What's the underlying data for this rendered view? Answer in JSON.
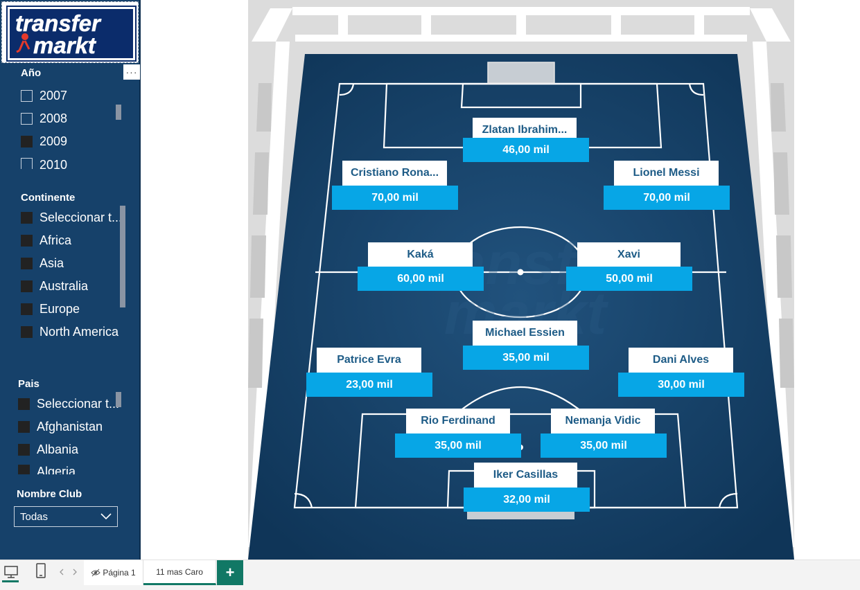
{
  "logo": {
    "line1": "transfer",
    "line2": "markt"
  },
  "slicers": {
    "year": {
      "title": "Año",
      "more_label": "···",
      "items": [
        {
          "label": "2007",
          "checked": false
        },
        {
          "label": "2008",
          "checked": false
        },
        {
          "label": "2009",
          "checked": true
        },
        {
          "label": "2010",
          "checked": false
        }
      ]
    },
    "continent": {
      "title": "Continente",
      "items": [
        {
          "label": "Seleccionar t...",
          "checked": true
        },
        {
          "label": "Africa",
          "checked": true
        },
        {
          "label": "Asia",
          "checked": true
        },
        {
          "label": "Australia",
          "checked": true
        },
        {
          "label": "Europe",
          "checked": true
        },
        {
          "label": "North America",
          "checked": true
        }
      ]
    },
    "country": {
      "title": "Pais",
      "items": [
        {
          "label": "Seleccionar t...",
          "checked": true
        },
        {
          "label": "Afghanistan",
          "checked": true
        },
        {
          "label": "Albania",
          "checked": true
        },
        {
          "label": "Algeria",
          "checked": true
        }
      ]
    },
    "club": {
      "title": "Nombre Club",
      "value": "Todas"
    }
  },
  "players": [
    {
      "name": "Zlatan Ibrahim...",
      "value": "46,00 mil"
    },
    {
      "name": "Cristiano Rona...",
      "value": "70,00 mil"
    },
    {
      "name": "Lionel Messi",
      "value": "70,00 mil"
    },
    {
      "name": "Kaká",
      "value": "60,00 mil"
    },
    {
      "name": "Xavi",
      "value": "50,00 mil"
    },
    {
      "name": "Michael Essien",
      "value": "35,00 mil"
    },
    {
      "name": "Patrice Evra",
      "value": "23,00 mil"
    },
    {
      "name": "Dani Alves",
      "value": "30,00 mil"
    },
    {
      "name": "Rio Ferdinand",
      "value": "35,00 mil"
    },
    {
      "name": "Nemanja Vidic",
      "value": "35,00 mil"
    },
    {
      "name": "Iker Casillas",
      "value": "32,00 mil"
    }
  ],
  "tabs": {
    "page1": "Página 1",
    "page2": "11 mas Caro",
    "add": "+"
  },
  "colors": {
    "sidebar": "#16416a",
    "pitch": "#163f66",
    "value_box": "#07a6e6",
    "name_text": "#1d5b86",
    "active_tab": "#117865"
  }
}
